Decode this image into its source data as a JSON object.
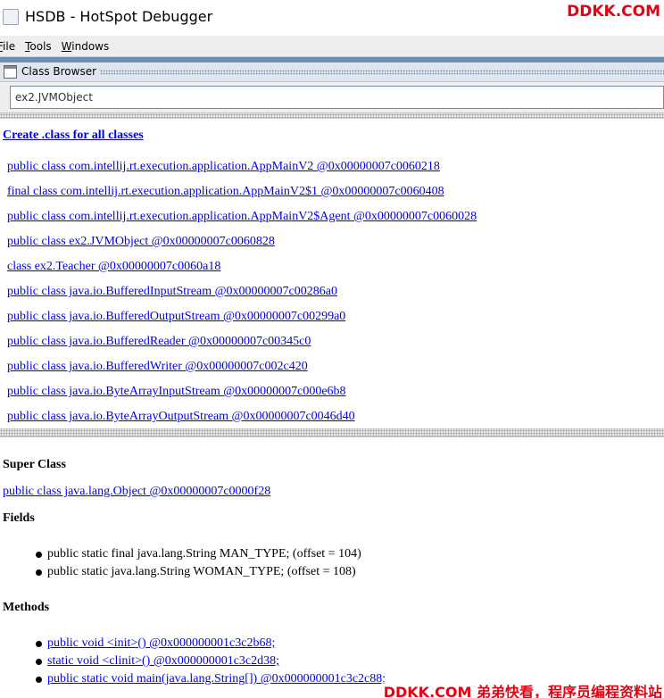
{
  "window": {
    "title": "HSDB - HotSpot Debugger",
    "watermark_top": "DDKK.COM",
    "watermark_bottom": "DDKK.COM 弟弟快看，程序员编程资料站"
  },
  "menubar": {
    "items": [
      {
        "mnemonic": "F",
        "rest": "ile"
      },
      {
        "mnemonic": "T",
        "rest": "ools"
      },
      {
        "mnemonic": "W",
        "rest": "indows"
      }
    ]
  },
  "class_browser": {
    "title": "Class Browser",
    "search_value": "ex2.JVMObject",
    "create_link": "Create .class for all classes",
    "classes": [
      "public class com.intellij.rt.execution.application.AppMainV2 @0x00000007c0060218",
      "final class com.intellij.rt.execution.application.AppMainV2$1 @0x00000007c0060408",
      "public class com.intellij.rt.execution.application.AppMainV2$Agent @0x00000007c0060028",
      "public class ex2.JVMObject @0x00000007c0060828",
      "class ex2.Teacher @0x00000007c0060a18",
      "public class java.io.BufferedInputStream @0x00000007c00286a0",
      "public class java.io.BufferedOutputStream @0x00000007c00299a0",
      "public class java.io.BufferedReader @0x00000007c00345c0",
      "public class java.io.BufferedWriter @0x00000007c002c420",
      "public class java.io.ByteArrayInputStream @0x00000007c000e6b8",
      "public class java.io.ByteArrayOutputStream @0x00000007c0046d40"
    ],
    "super_class_heading": "Super Class",
    "super_class": "public class java.lang.Object @0x00000007c0000f28",
    "fields_heading": "Fields",
    "fields": [
      "public static final java.lang.String MAN_TYPE; (offset = 104)",
      "public static java.lang.String WOMAN_TYPE; (offset = 108)"
    ],
    "methods_heading": "Methods",
    "methods": [
      "public void <init>() @0x000000001c3c2b68;",
      "static void <clinit>() @0x000000001c3c2d38;",
      "public static void main(java.lang.String[]) @0x000000001c3c2c88;"
    ]
  }
}
